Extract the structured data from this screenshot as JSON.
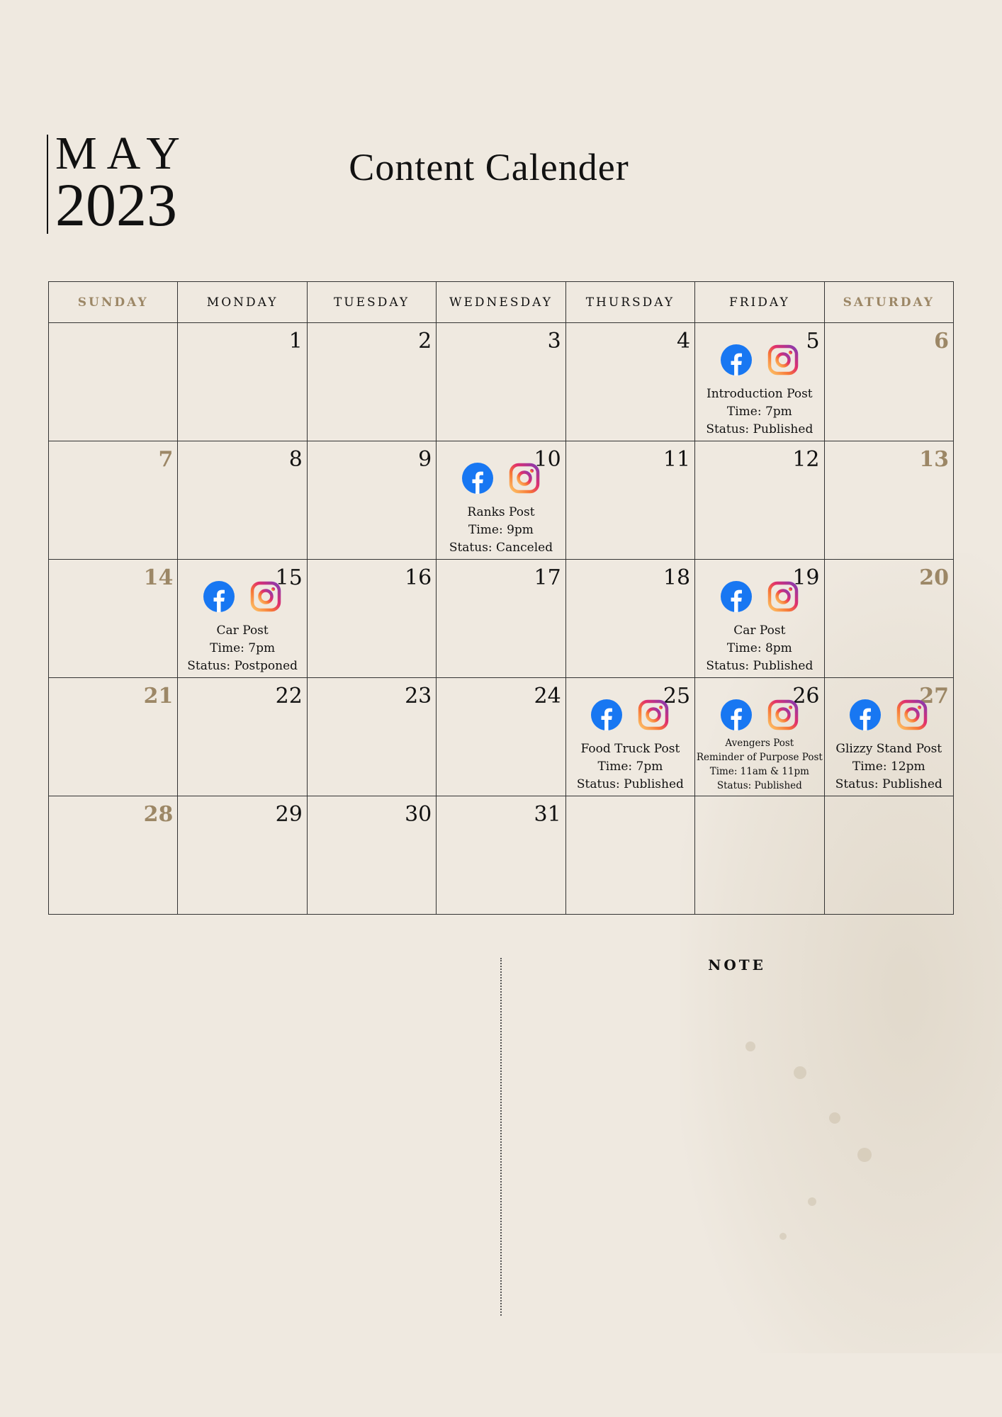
{
  "header": {
    "month": "MAY",
    "year": "2023",
    "title": "Content Calender"
  },
  "weekdays": [
    {
      "label": "SUNDAY",
      "weekend": true
    },
    {
      "label": "MONDAY",
      "weekend": false
    },
    {
      "label": "TUESDAY",
      "weekend": false
    },
    {
      "label": "WEDNESDAY",
      "weekend": false
    },
    {
      "label": "THURSDAY",
      "weekend": false
    },
    {
      "label": "FRIDAY",
      "weekend": false
    },
    {
      "label": "SATURDAY",
      "weekend": true
    }
  ],
  "weeks": [
    [
      "",
      "1",
      "2",
      "3",
      "4",
      "5",
      "6"
    ],
    [
      "7",
      "8",
      "9",
      "10",
      "11",
      "12",
      "13"
    ],
    [
      "14",
      "15",
      "16",
      "17",
      "18",
      "19",
      "20"
    ],
    [
      "21",
      "22",
      "23",
      "24",
      "25",
      "26",
      "27"
    ],
    [
      "28",
      "29",
      "30",
      "31",
      "",
      "",
      ""
    ]
  ],
  "events": {
    "5": {
      "lines": [
        "Introduction Post",
        "Time: 7pm",
        "Status: Published"
      ],
      "small": false
    },
    "10": {
      "lines": [
        "Ranks Post",
        "Time: 9pm",
        "Status: Canceled"
      ],
      "small": false
    },
    "15": {
      "lines": [
        "Car Post",
        "Time: 7pm",
        "Status: Postponed"
      ],
      "small": false
    },
    "19": {
      "lines": [
        "Car Post",
        "Time: 8pm",
        "Status: Published"
      ],
      "small": false
    },
    "25": {
      "lines": [
        "Food Truck Post",
        "Time: 7pm",
        "Status: Published"
      ],
      "small": false
    },
    "26": {
      "lines": [
        "Avengers Post",
        "Reminder of Purpose Post",
        "Time: 11am & 11pm",
        "Status: Published"
      ],
      "small": true
    },
    "27": {
      "lines": [
        "Glizzy Stand Post",
        "Time: 12pm",
        "Status: Published"
      ],
      "small": false
    }
  },
  "icons": [
    "facebook-icon",
    "instagram-icon"
  ],
  "colors": {
    "background": "#efe9e0",
    "weekend": "#9c8766",
    "facebook": "#1877f2"
  },
  "note": {
    "heading": "NOTE"
  }
}
